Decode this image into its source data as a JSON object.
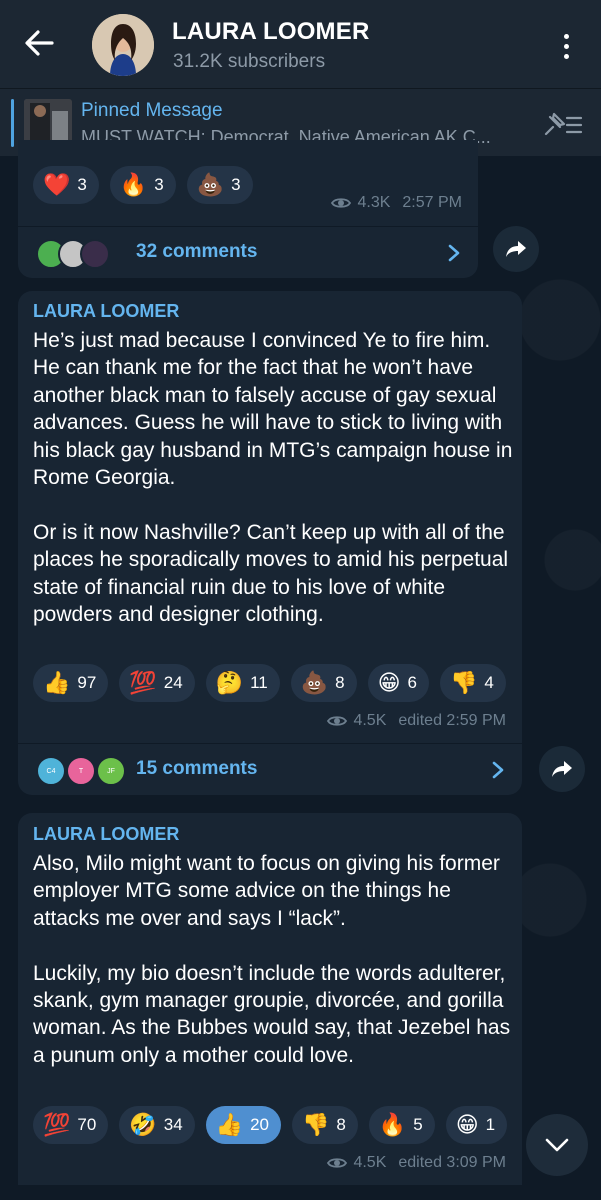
{
  "header": {
    "title": "LAURA LOOMER",
    "subtitle": "31.2K subscribers"
  },
  "pinned": {
    "title": "Pinned Message",
    "text": "MUST WATCH: Democrat, Native American AK C..."
  },
  "message0": {
    "reactions": [
      {
        "emoji": "❤️",
        "count": "3"
      },
      {
        "emoji": "🔥",
        "count": "3"
      },
      {
        "emoji": "💩",
        "count": "3"
      }
    ],
    "views": "4.3K",
    "time": "2:57 PM",
    "comments": "32 comments"
  },
  "message1": {
    "sender": "LAURA LOOMER",
    "text": "He’s just mad because I convinced Ye to fire him. He can thank me for the fact that he won’t have another black man to falsely accuse of gay sexual advances. Guess he will have to stick to living with his black gay husband in MTG’s campaign house in Rome Georgia.\n\nOr is it now Nashville? Can’t keep up with all of the places he sporadically moves to amid his perpetual state of financial ruin due to his love of white powders and designer clothing.",
    "reactions": [
      {
        "emoji": "👍",
        "count": "97"
      },
      {
        "emoji": "💯",
        "count": "24"
      },
      {
        "emoji": "🤔",
        "count": "11"
      },
      {
        "emoji": "💩",
        "count": "8"
      },
      {
        "emoji": "😁",
        "count": "6"
      },
      {
        "emoji": "👎",
        "count": "4"
      }
    ],
    "views": "4.5K",
    "time": "edited 2:59 PM",
    "comments": "15 comments",
    "comment_avatars": [
      "C4",
      "T",
      "JF"
    ]
  },
  "message2": {
    "sender": "LAURA LOOMER",
    "text": "Also, Milo might want to focus on giving his former employer MTG some advice on the things he attacks me over and says I “lack”.\n\nLuckily, my bio doesn’t include the words adulterer, skank, gym manager groupie, divorcée, and gorilla woman. As the Bubbes would say, that Jezebel has a punum only a mother could love.",
    "reactions": [
      {
        "emoji": "💯",
        "count": "70"
      },
      {
        "emoji": "🤣",
        "count": "34"
      },
      {
        "emoji": "👍",
        "count": "20"
      },
      {
        "emoji": "👎",
        "count": "8"
      },
      {
        "emoji": "🔥",
        "count": "5"
      },
      {
        "emoji": "😁",
        "count": "1"
      }
    ],
    "views": "4.5K",
    "time": "edited 3:09 PM"
  },
  "colors": {
    "accent": "#64b5ef",
    "bubble": "#182533",
    "header": "#1c2733",
    "active_reaction": "#4f8fd0"
  }
}
